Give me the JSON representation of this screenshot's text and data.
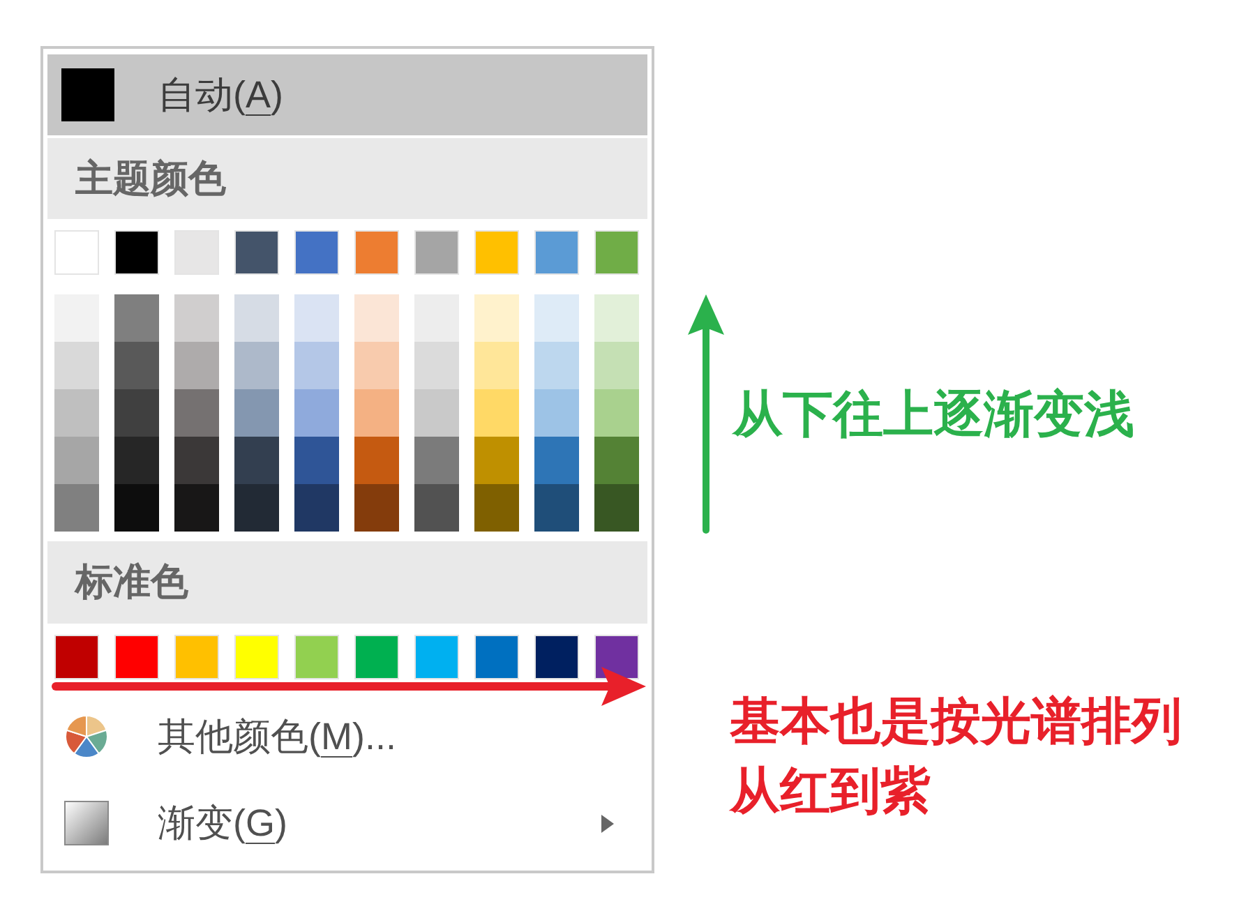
{
  "menu": {
    "automatic": {
      "color": "#000000",
      "text_before": "自动(",
      "access_key": "A",
      "text_after": ")",
      "highlighted": true
    },
    "sections": [
      {
        "heading": "主题颜色",
        "base_colors": [
          {
            "color": "#ffffff"
          },
          {
            "color": "#000000"
          },
          {
            "color": "#e7e6e6"
          },
          {
            "color": "#44546a"
          },
          {
            "color": "#4472c4"
          },
          {
            "color": "#ed7d31"
          },
          {
            "color": "#a5a5a5"
          },
          {
            "color": "#ffc000"
          },
          {
            "color": "#5b9bd5"
          },
          {
            "color": "#70ad47"
          }
        ],
        "shade_columns": [
          {
            "colors": [
              {
                "color": "#f2f2f2"
              },
              {
                "color": "#d9d9d9"
              },
              {
                "color": "#bfbfbf"
              },
              {
                "color": "#a6a6a6"
              },
              {
                "color": "#808080"
              }
            ]
          },
          {
            "colors": [
              {
                "color": "#7f7f7f"
              },
              {
                "color": "#595959"
              },
              {
                "color": "#404040"
              },
              {
                "color": "#262626"
              },
              {
                "color": "#0d0d0d"
              }
            ]
          },
          {
            "colors": [
              {
                "color": "#d0cece"
              },
              {
                "color": "#aeabab"
              },
              {
                "color": "#757171"
              },
              {
                "color": "#3b3838"
              },
              {
                "color": "#181717"
              }
            ]
          },
          {
            "colors": [
              {
                "color": "#d6dce5"
              },
              {
                "color": "#adb9ca"
              },
              {
                "color": "#8497b0"
              },
              {
                "color": "#333f50"
              },
              {
                "color": "#222a35"
              }
            ]
          },
          {
            "colors": [
              {
                "color": "#dae3f3"
              },
              {
                "color": "#b4c7e7"
              },
              {
                "color": "#8faadc"
              },
              {
                "color": "#2f5597"
              },
              {
                "color": "#203864"
              }
            ]
          },
          {
            "colors": [
              {
                "color": "#fbe5d6"
              },
              {
                "color": "#f8cbad"
              },
              {
                "color": "#f4b183"
              },
              {
                "color": "#c55a11"
              },
              {
                "color": "#843c0c"
              }
            ]
          },
          {
            "colors": [
              {
                "color": "#ededed"
              },
              {
                "color": "#dbdbdb"
              },
              {
                "color": "#c9c9c9"
              },
              {
                "color": "#7b7b7b"
              },
              {
                "color": "#525252"
              }
            ]
          },
          {
            "colors": [
              {
                "color": "#fff2cc"
              },
              {
                "color": "#ffe699"
              },
              {
                "color": "#ffd966"
              },
              {
                "color": "#bf9000"
              },
              {
                "color": "#7f6000"
              }
            ]
          },
          {
            "colors": [
              {
                "color": "#deebf7"
              },
              {
                "color": "#bdd7ee"
              },
              {
                "color": "#9dc3e6"
              },
              {
                "color": "#2e75b6"
              },
              {
                "color": "#1f4e79"
              }
            ]
          },
          {
            "colors": [
              {
                "color": "#e2f0d9"
              },
              {
                "color": "#c5e0b4"
              },
              {
                "color": "#a9d18e"
              },
              {
                "color": "#548235"
              },
              {
                "color": "#385723"
              }
            ]
          }
        ]
      },
      {
        "heading": "标准色",
        "base_colors": [
          {
            "color": "#c00000"
          },
          {
            "color": "#ff0000"
          },
          {
            "color": "#ffc000"
          },
          {
            "color": "#ffff00"
          },
          {
            "color": "#92d050"
          },
          {
            "color": "#00b050"
          },
          {
            "color": "#00b0f0"
          },
          {
            "color": "#0070c0"
          },
          {
            "color": "#002060"
          },
          {
            "color": "#7030a0"
          }
        ]
      }
    ],
    "items": [
      {
        "kind": "more-colors",
        "text_before": "其他颜色(",
        "access_key": "M",
        "text_after": ")...",
        "highlighted": false,
        "submenu": false
      },
      {
        "kind": "gradient",
        "text_before": "渐变(",
        "access_key": "G",
        "text_after": ")",
        "highlighted": false,
        "submenu": true
      }
    ]
  },
  "annotations": [
    {
      "kind": "up-arrow",
      "color": "#2bb14c",
      "lines": [
        "从下往上逐渐变浅"
      ]
    },
    {
      "kind": "right-arrow",
      "color": "#e8202a",
      "lines": [
        "基本也是按光谱排列",
        "从红到紫"
      ]
    }
  ]
}
